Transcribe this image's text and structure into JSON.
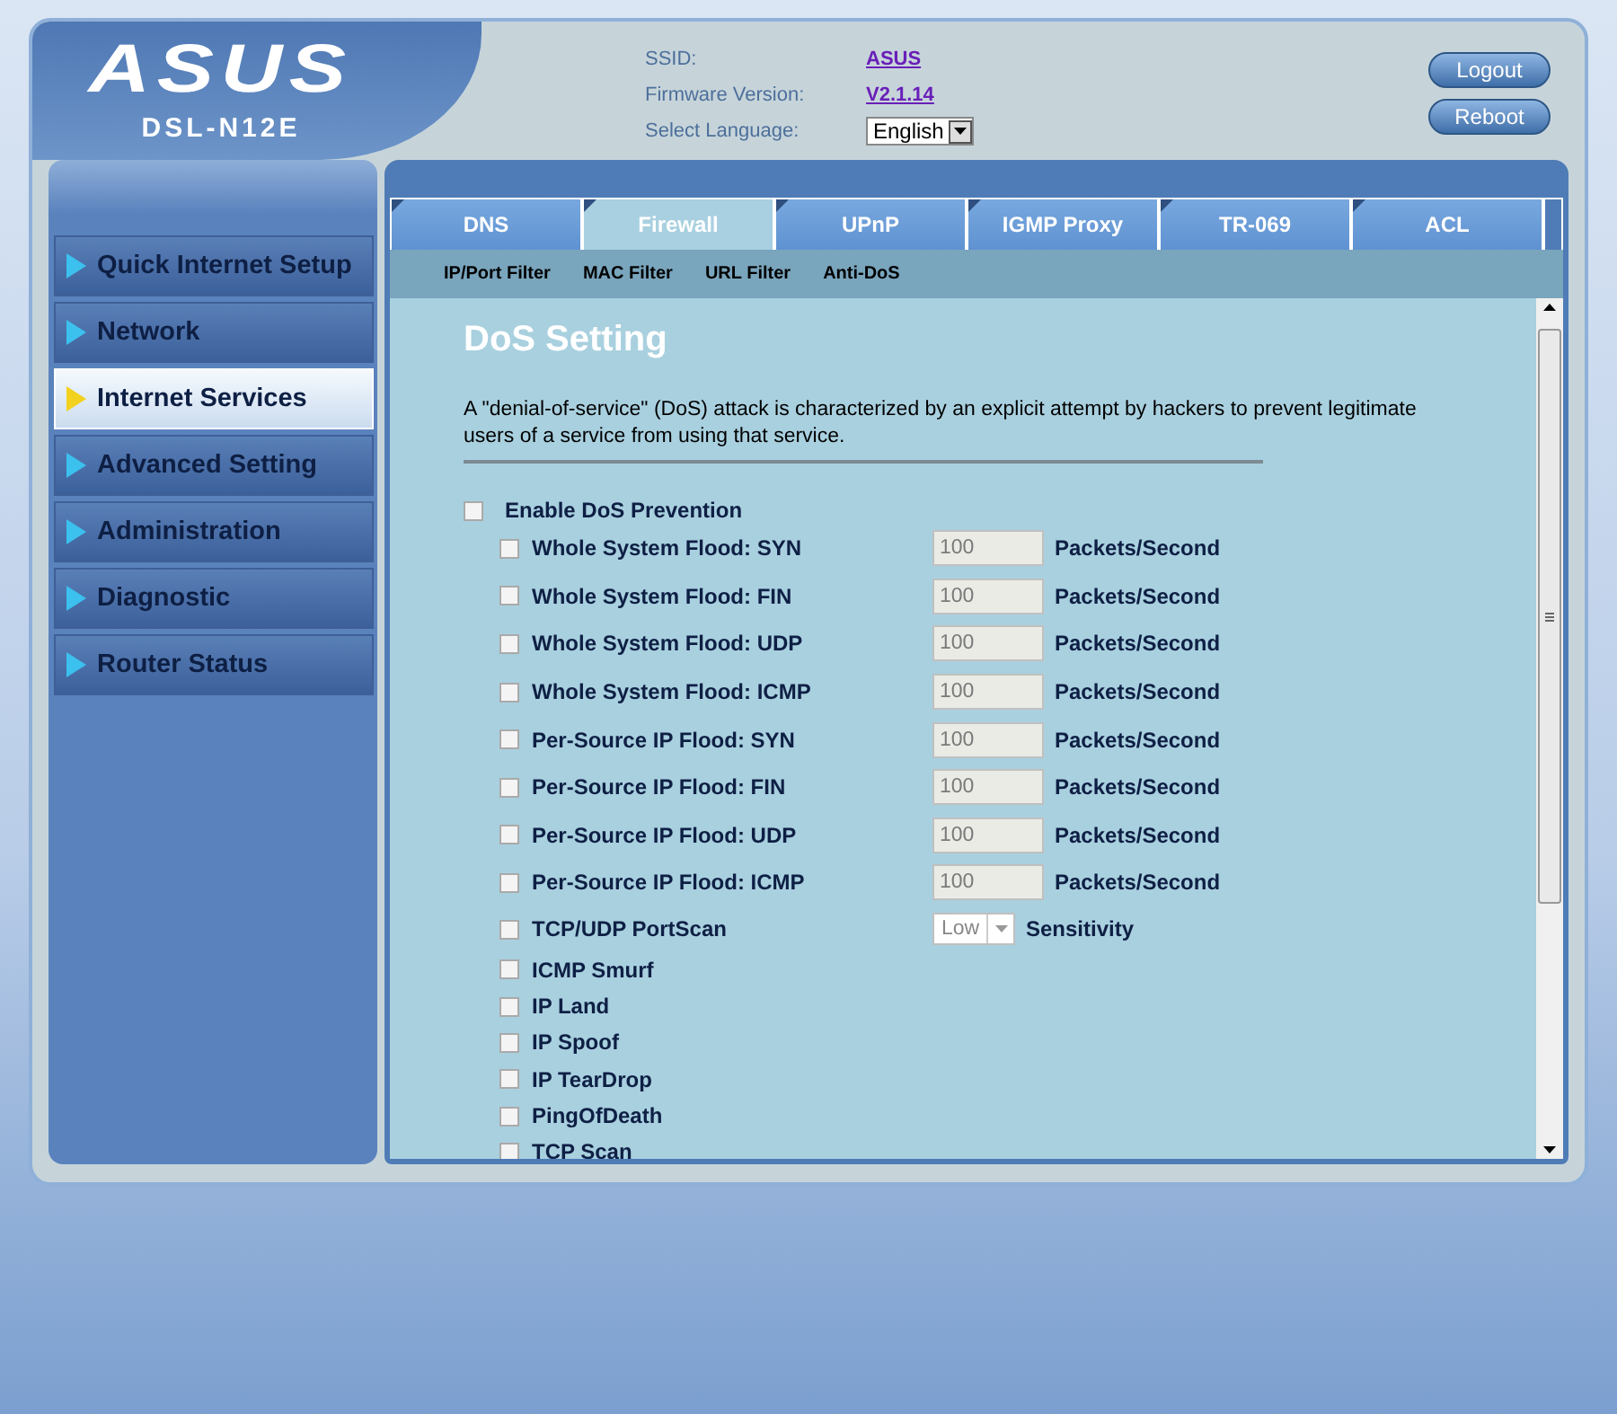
{
  "header": {
    "brand": "ASUS",
    "model": "DSL-N12E",
    "info": [
      {
        "label": "SSID:",
        "value": "ASUS"
      },
      {
        "label": "Firmware Version:",
        "value": "V2.1.14"
      }
    ],
    "language": {
      "label": "Select Language:",
      "value": "English"
    },
    "buttons": [
      "Logout",
      "Reboot"
    ]
  },
  "sidebar": {
    "items": [
      {
        "label": "Quick Internet Setup",
        "selected": false
      },
      {
        "label": "Network",
        "selected": false
      },
      {
        "label": "Internet Services",
        "selected": true
      },
      {
        "label": "Advanced Setting",
        "selected": false
      },
      {
        "label": "Administration",
        "selected": false
      },
      {
        "label": "Diagnostic",
        "selected": false
      },
      {
        "label": "Router Status",
        "selected": false
      }
    ]
  },
  "tabs": [
    {
      "label": "DNS",
      "selected": false
    },
    {
      "label": "Firewall",
      "selected": true
    },
    {
      "label": "UPnP",
      "selected": false
    },
    {
      "label": "IGMP Proxy",
      "selected": false
    },
    {
      "label": "TR-069",
      "selected": false
    },
    {
      "label": "ACL",
      "selected": false
    }
  ],
  "subtabs": [
    "IP/Port Filter",
    "MAC Filter",
    "URL Filter",
    "Anti-DoS"
  ],
  "content": {
    "title": "DoS Setting",
    "description": "A \"denial-of-service\" (DoS) attack is characterized by an explicit attempt by hackers to prevent legitimate users of a service from using that service.",
    "enable": {
      "label": "Enable DoS Prevention",
      "checked": false
    },
    "rows": [
      {
        "kind": "flood",
        "label": "Whole System Flood: SYN",
        "checked": false,
        "value": "100",
        "unit": "Packets/Second"
      },
      {
        "kind": "flood",
        "label": "Whole System Flood: FIN",
        "checked": false,
        "value": "100",
        "unit": "Packets/Second"
      },
      {
        "kind": "flood",
        "label": "Whole System Flood: UDP",
        "checked": false,
        "value": "100",
        "unit": "Packets/Second"
      },
      {
        "kind": "flood",
        "label": "Whole System Flood: ICMP",
        "checked": false,
        "value": "100",
        "unit": "Packets/Second"
      },
      {
        "kind": "flood",
        "label": "Per-Source IP Flood: SYN",
        "checked": false,
        "value": "100",
        "unit": "Packets/Second"
      },
      {
        "kind": "flood",
        "label": "Per-Source IP Flood: FIN",
        "checked": false,
        "value": "100",
        "unit": "Packets/Second"
      },
      {
        "kind": "flood",
        "label": "Per-Source IP Flood: UDP",
        "checked": false,
        "value": "100",
        "unit": "Packets/Second"
      },
      {
        "kind": "flood",
        "label": "Per-Source IP Flood: ICMP",
        "checked": false,
        "value": "100",
        "unit": "Packets/Second"
      },
      {
        "kind": "portscan",
        "label": "TCP/UDP PortScan",
        "checked": false,
        "value": "Low",
        "unit": "Sensitivity"
      },
      {
        "kind": "simple",
        "label": "ICMP Smurf",
        "checked": false
      },
      {
        "kind": "simple",
        "label": "IP Land",
        "checked": false
      },
      {
        "kind": "simple",
        "label": "IP Spoof",
        "checked": false
      },
      {
        "kind": "simple",
        "label": "IP TearDrop",
        "checked": false
      },
      {
        "kind": "simple",
        "label": "PingOfDeath",
        "checked": false
      },
      {
        "kind": "simple",
        "label": "TCP Scan",
        "checked": false
      }
    ]
  }
}
